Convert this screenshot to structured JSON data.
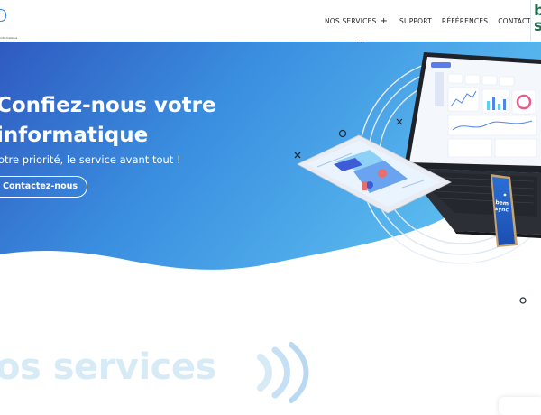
{
  "header": {
    "logo": {
      "tagline": "informatique"
    },
    "nav": [
      {
        "label": "NOS SERVICES",
        "has_submenu": true,
        "submenu_icon": "plus-icon"
      },
      {
        "label": "SUPPORT"
      },
      {
        "label": "RÉFÉRENCES"
      },
      {
        "label": "CONTACT"
      }
    ],
    "partner_badge": {
      "line1": "b",
      "line2": "sy"
    }
  },
  "hero": {
    "title": "Confiez-nous votre\ninformatique",
    "subtitle": "otre priorité, le service avant tout !",
    "cta_label": "Contactez-nous",
    "phone_screen": {
      "line1": "bem",
      "line2": "sync"
    },
    "gradient": [
      "#2f5fc2",
      "#3a8fe0",
      "#55b7ee"
    ]
  },
  "services": {
    "heading": "os services"
  },
  "colors": {
    "accent": "#3a88dd",
    "heading_faded": "#d7ebf7",
    "brand_green": "#1e6e4f"
  }
}
